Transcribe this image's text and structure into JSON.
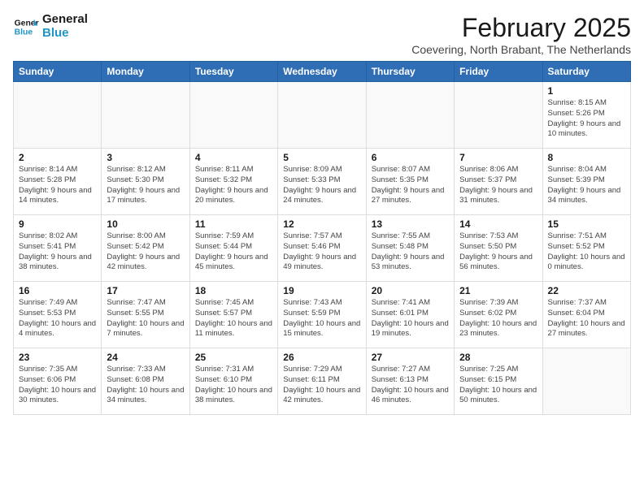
{
  "logo": {
    "line1": "General",
    "line2": "Blue"
  },
  "title": "February 2025",
  "subtitle": "Coevering, North Brabant, The Netherlands",
  "weekdays": [
    "Sunday",
    "Monday",
    "Tuesday",
    "Wednesday",
    "Thursday",
    "Friday",
    "Saturday"
  ],
  "weeks": [
    [
      {
        "day": "",
        "info": ""
      },
      {
        "day": "",
        "info": ""
      },
      {
        "day": "",
        "info": ""
      },
      {
        "day": "",
        "info": ""
      },
      {
        "day": "",
        "info": ""
      },
      {
        "day": "",
        "info": ""
      },
      {
        "day": "1",
        "info": "Sunrise: 8:15 AM\nSunset: 5:26 PM\nDaylight: 9 hours and 10 minutes."
      }
    ],
    [
      {
        "day": "2",
        "info": "Sunrise: 8:14 AM\nSunset: 5:28 PM\nDaylight: 9 hours and 14 minutes."
      },
      {
        "day": "3",
        "info": "Sunrise: 8:12 AM\nSunset: 5:30 PM\nDaylight: 9 hours and 17 minutes."
      },
      {
        "day": "4",
        "info": "Sunrise: 8:11 AM\nSunset: 5:32 PM\nDaylight: 9 hours and 20 minutes."
      },
      {
        "day": "5",
        "info": "Sunrise: 8:09 AM\nSunset: 5:33 PM\nDaylight: 9 hours and 24 minutes."
      },
      {
        "day": "6",
        "info": "Sunrise: 8:07 AM\nSunset: 5:35 PM\nDaylight: 9 hours and 27 minutes."
      },
      {
        "day": "7",
        "info": "Sunrise: 8:06 AM\nSunset: 5:37 PM\nDaylight: 9 hours and 31 minutes."
      },
      {
        "day": "8",
        "info": "Sunrise: 8:04 AM\nSunset: 5:39 PM\nDaylight: 9 hours and 34 minutes."
      }
    ],
    [
      {
        "day": "9",
        "info": "Sunrise: 8:02 AM\nSunset: 5:41 PM\nDaylight: 9 hours and 38 minutes."
      },
      {
        "day": "10",
        "info": "Sunrise: 8:00 AM\nSunset: 5:42 PM\nDaylight: 9 hours and 42 minutes."
      },
      {
        "day": "11",
        "info": "Sunrise: 7:59 AM\nSunset: 5:44 PM\nDaylight: 9 hours and 45 minutes."
      },
      {
        "day": "12",
        "info": "Sunrise: 7:57 AM\nSunset: 5:46 PM\nDaylight: 9 hours and 49 minutes."
      },
      {
        "day": "13",
        "info": "Sunrise: 7:55 AM\nSunset: 5:48 PM\nDaylight: 9 hours and 53 minutes."
      },
      {
        "day": "14",
        "info": "Sunrise: 7:53 AM\nSunset: 5:50 PM\nDaylight: 9 hours and 56 minutes."
      },
      {
        "day": "15",
        "info": "Sunrise: 7:51 AM\nSunset: 5:52 PM\nDaylight: 10 hours and 0 minutes."
      }
    ],
    [
      {
        "day": "16",
        "info": "Sunrise: 7:49 AM\nSunset: 5:53 PM\nDaylight: 10 hours and 4 minutes."
      },
      {
        "day": "17",
        "info": "Sunrise: 7:47 AM\nSunset: 5:55 PM\nDaylight: 10 hours and 7 minutes."
      },
      {
        "day": "18",
        "info": "Sunrise: 7:45 AM\nSunset: 5:57 PM\nDaylight: 10 hours and 11 minutes."
      },
      {
        "day": "19",
        "info": "Sunrise: 7:43 AM\nSunset: 5:59 PM\nDaylight: 10 hours and 15 minutes."
      },
      {
        "day": "20",
        "info": "Sunrise: 7:41 AM\nSunset: 6:01 PM\nDaylight: 10 hours and 19 minutes."
      },
      {
        "day": "21",
        "info": "Sunrise: 7:39 AM\nSunset: 6:02 PM\nDaylight: 10 hours and 23 minutes."
      },
      {
        "day": "22",
        "info": "Sunrise: 7:37 AM\nSunset: 6:04 PM\nDaylight: 10 hours and 27 minutes."
      }
    ],
    [
      {
        "day": "23",
        "info": "Sunrise: 7:35 AM\nSunset: 6:06 PM\nDaylight: 10 hours and 30 minutes."
      },
      {
        "day": "24",
        "info": "Sunrise: 7:33 AM\nSunset: 6:08 PM\nDaylight: 10 hours and 34 minutes."
      },
      {
        "day": "25",
        "info": "Sunrise: 7:31 AM\nSunset: 6:10 PM\nDaylight: 10 hours and 38 minutes."
      },
      {
        "day": "26",
        "info": "Sunrise: 7:29 AM\nSunset: 6:11 PM\nDaylight: 10 hours and 42 minutes."
      },
      {
        "day": "27",
        "info": "Sunrise: 7:27 AM\nSunset: 6:13 PM\nDaylight: 10 hours and 46 minutes."
      },
      {
        "day": "28",
        "info": "Sunrise: 7:25 AM\nSunset: 6:15 PM\nDaylight: 10 hours and 50 minutes."
      },
      {
        "day": "",
        "info": ""
      }
    ]
  ]
}
